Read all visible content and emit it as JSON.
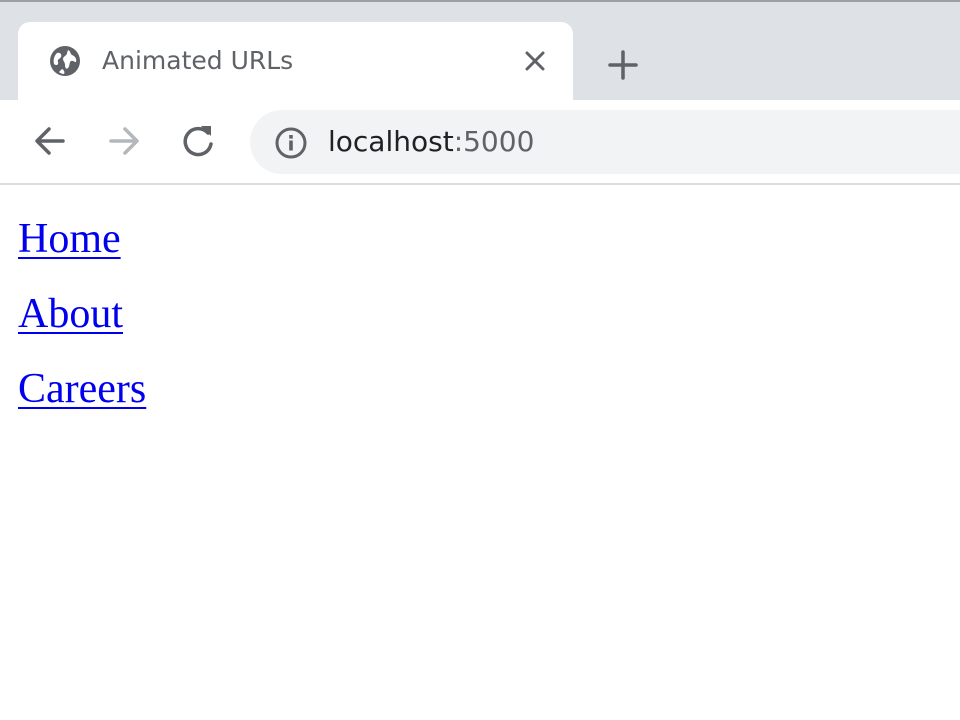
{
  "tab": {
    "icon": "globe-icon",
    "title": "Animated URLs",
    "close_icon": "close-icon"
  },
  "new_tab_icon": "plus-icon",
  "toolbar": {
    "back_icon": "arrow-left-icon",
    "forward_icon": "arrow-right-icon",
    "reload_icon": "reload-icon",
    "info_icon": "info-icon"
  },
  "address": {
    "host": "localhost",
    "port": ":5000"
  },
  "links": [
    {
      "label": "Home"
    },
    {
      "label": "About"
    },
    {
      "label": "Careers"
    }
  ],
  "colors": {
    "tab_strip": "#dee1e6",
    "omnibox": "#f1f3f4",
    "link": "#0000ee",
    "icon": "#5f6368"
  }
}
